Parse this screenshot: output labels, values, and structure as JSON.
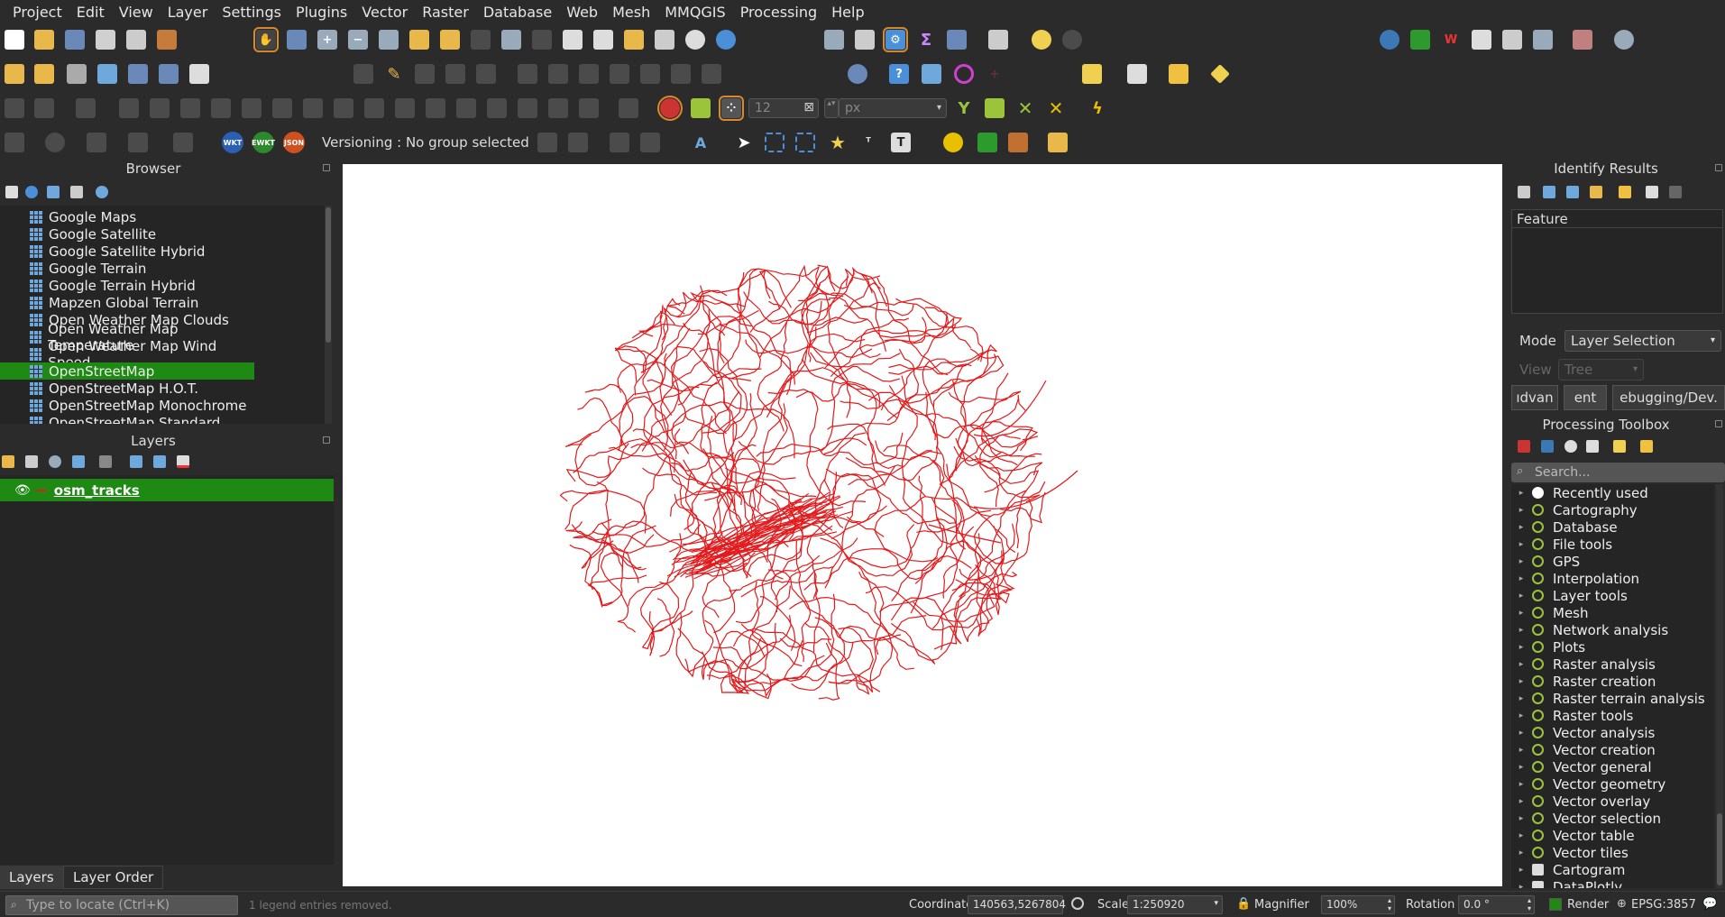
{
  "menubar": [
    "Project",
    "Edit",
    "View",
    "Layer",
    "Settings",
    "Plugins",
    "Vector",
    "Raster",
    "Database",
    "Web",
    "Mesh",
    "MMQGIS",
    "Processing",
    "Help"
  ],
  "toolbar": {
    "snapping_tolerance": "12",
    "snapping_units": "px",
    "versioning_label": "Versioning : No group selected",
    "wkt_label": "WKT",
    "ewkt_label": "EWKT",
    "json_label": "JSON"
  },
  "browser": {
    "title": "Browser",
    "items": [
      "Google Maps",
      "Google Satellite",
      "Google Satellite Hybrid",
      "Google Terrain",
      "Google Terrain Hybrid",
      "Mapzen Global Terrain",
      "Open Weather Map Clouds",
      "Open Weather Map Temperature",
      "Open Weather Map Wind Speed",
      "OpenStreetMap",
      "OpenStreetMap H.O.T.",
      "OpenStreetMap Monochrome",
      "OpenStreetMap Standard"
    ],
    "selected": "OpenStreetMap"
  },
  "layers": {
    "title": "Layers",
    "items": [
      {
        "name": "osm_tracks",
        "visible": true,
        "color": "#e31a1c"
      }
    ]
  },
  "bottom_tabs": [
    "Layers",
    "Layer Order"
  ],
  "identify": {
    "title": "Identify Results",
    "column_header": "Feature",
    "mode_label": "Mode",
    "mode_value": "Layer Selection",
    "view_label": "View",
    "view_value": "Tree",
    "tabs": [
      "ıdvan",
      "ent",
      "ebugging/Dev."
    ]
  },
  "toolbox": {
    "title": "Processing Toolbox",
    "search_placeholder": "Search...",
    "items": [
      "Recently used",
      "Cartography",
      "Database",
      "File tools",
      "GPS",
      "Interpolation",
      "Layer tools",
      "Mesh",
      "Network analysis",
      "Plots",
      "Raster analysis",
      "Raster creation",
      "Raster terrain analysis",
      "Raster tools",
      "Vector analysis",
      "Vector creation",
      "Vector general",
      "Vector geometry",
      "Vector overlay",
      "Vector selection",
      "Vector table",
      "Vector tiles",
      "Cartogram",
      "DataPlotly"
    ]
  },
  "status": {
    "locator_placeholder": "Type to locate (Ctrl+K)",
    "message": "1 legend entries removed.",
    "coordinate_label": "Coordinate",
    "coordinate_value": "140563,5267804",
    "scale_label": "Scale",
    "scale_value": "1:250920",
    "magnifier_label": "Magnifier",
    "magnifier_value": "100%",
    "rotation_label": "Rotation",
    "rotation_value": "0.0 °",
    "render_label": "Render",
    "crs_label": "EPSG:3857"
  },
  "colors": {
    "selection": "#1e8a13",
    "tracks": "#e31a1c",
    "panel_bg": "#2b2b2b"
  }
}
